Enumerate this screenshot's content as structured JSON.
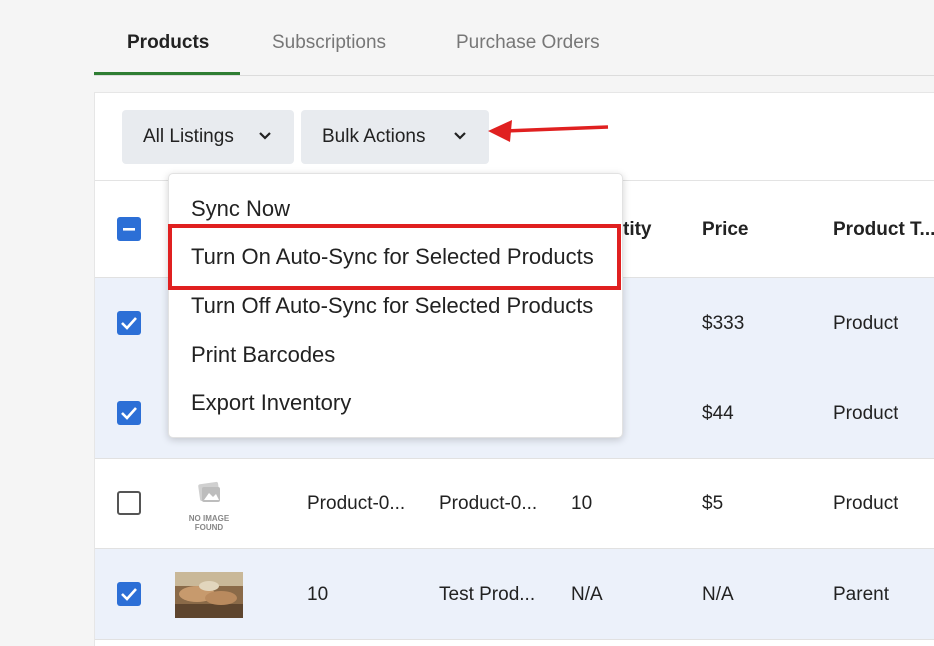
{
  "tabs": [
    {
      "label": "Products"
    },
    {
      "label": "Subscriptions"
    },
    {
      "label": "Purchase Orders"
    }
  ],
  "toolbar": {
    "listings_label": "All Listings",
    "bulk_label": "Bulk Actions"
  },
  "table": {
    "headers": {
      "quantity": "tity",
      "price": "Price",
      "product_type": "Product T..."
    },
    "rows": [
      {
        "checked": true,
        "price": "$333",
        "type": "Product"
      },
      {
        "checked": true,
        "price": "$44",
        "type": "Product"
      },
      {
        "checked": false,
        "image": "no-image",
        "no_image_text": [
          "NO IMAGE",
          "FOUND"
        ],
        "sku": "Product-0...",
        "name": "Product-0...",
        "qty": "10",
        "price": "$5",
        "type": "Product"
      },
      {
        "checked": true,
        "image": "photo",
        "sku": "10",
        "name": "Test Prod...",
        "qty": "N/A",
        "price": "N/A",
        "type": "Parent"
      }
    ]
  },
  "bulk_menu": {
    "items": [
      {
        "label": "Sync Now"
      },
      {
        "label": "Turn On Auto-Sync for Selected Products",
        "highlighted": true
      },
      {
        "label": "Turn Off Auto-Sync for Selected Products"
      },
      {
        "label": "Print Barcodes"
      },
      {
        "label": "Export Inventory"
      }
    ]
  },
  "colors": {
    "accent_green": "#2e7d32",
    "checkbox_blue": "#2c6fd6",
    "annotation_red": "#e02020",
    "selected_row": "#ecf1fa"
  }
}
